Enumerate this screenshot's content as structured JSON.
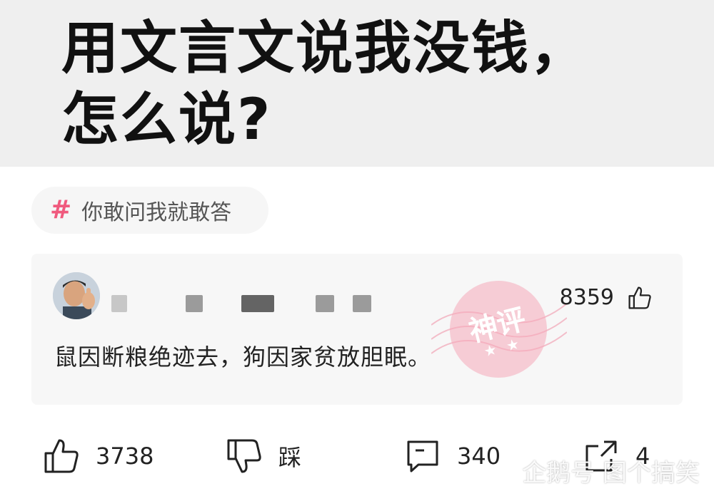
{
  "question": {
    "title_line1": "用文言文说我没钱，",
    "title_line2": "怎么说?"
  },
  "topic_tag": {
    "icon": "hash-icon",
    "label": "你敢问我就敢答"
  },
  "comment": {
    "like_count": "8359",
    "text": "鼠因断粮绝迹去，狗因家贫放胆眠。",
    "stamp_label": "神评"
  },
  "action_bar": {
    "like_count": "3738",
    "dislike_label": "踩",
    "comment_count": "340",
    "share_count": "4"
  },
  "watermark": {
    "text": "企鹅号 图个搞笑"
  },
  "colors": {
    "accent_pink": "#f05a7e",
    "header_bg": "#efefef",
    "card_bg": "#f7f7f7"
  }
}
